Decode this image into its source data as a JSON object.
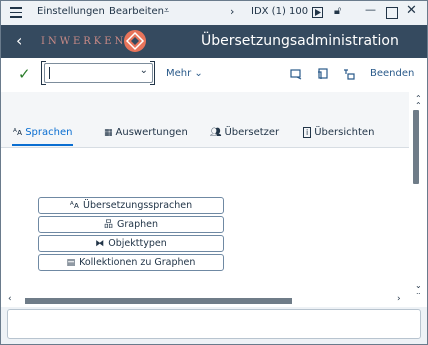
{
  "menubar": {
    "settings": "Einstellungen",
    "edit": "Bearbeiten",
    "system_id": "IDX (1) 100"
  },
  "shell": {
    "logo_text": "INWERKEN",
    "title": "Übersetzungsadministration"
  },
  "toolbar": {
    "combo_value": "",
    "more_label": "Mehr",
    "exit_label": "Beenden"
  },
  "tabs": [
    {
      "label": "Sprachen",
      "active": true
    },
    {
      "label": "Auswertungen"
    },
    {
      "label": "Übersetzer"
    },
    {
      "label": "Übersichten"
    }
  ],
  "buttons": [
    {
      "label": "Übersetzungssprachen"
    },
    {
      "label": "Graphen"
    },
    {
      "label": "Objekttypen"
    },
    {
      "label": "Kollektionen zu Graphen"
    }
  ],
  "colors": {
    "shell_bg": "#354a5f",
    "accent": "#0a6ed1",
    "logo": "#e8745b",
    "check": "#2b7d2b"
  }
}
